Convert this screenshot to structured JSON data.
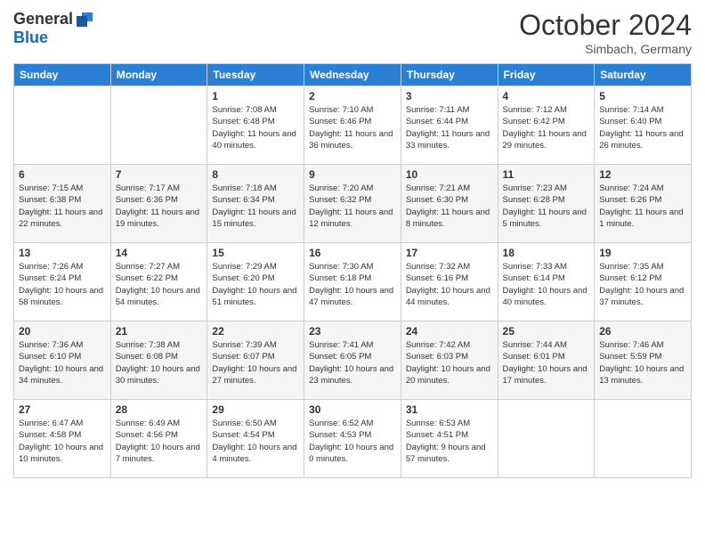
{
  "header": {
    "logo_general": "General",
    "logo_blue": "Blue",
    "month_title": "October 2024",
    "subtitle": "Simbach, Germany"
  },
  "days_of_week": [
    "Sunday",
    "Monday",
    "Tuesday",
    "Wednesday",
    "Thursday",
    "Friday",
    "Saturday"
  ],
  "weeks": [
    [
      {
        "day": "",
        "info": ""
      },
      {
        "day": "",
        "info": ""
      },
      {
        "day": "1",
        "info": "Sunrise: 7:08 AM\nSunset: 6:48 PM\nDaylight: 11 hours and 40 minutes."
      },
      {
        "day": "2",
        "info": "Sunrise: 7:10 AM\nSunset: 6:46 PM\nDaylight: 11 hours and 36 minutes."
      },
      {
        "day": "3",
        "info": "Sunrise: 7:11 AM\nSunset: 6:44 PM\nDaylight: 11 hours and 33 minutes."
      },
      {
        "day": "4",
        "info": "Sunrise: 7:12 AM\nSunset: 6:42 PM\nDaylight: 11 hours and 29 minutes."
      },
      {
        "day": "5",
        "info": "Sunrise: 7:14 AM\nSunset: 6:40 PM\nDaylight: 11 hours and 26 minutes."
      }
    ],
    [
      {
        "day": "6",
        "info": "Sunrise: 7:15 AM\nSunset: 6:38 PM\nDaylight: 11 hours and 22 minutes."
      },
      {
        "day": "7",
        "info": "Sunrise: 7:17 AM\nSunset: 6:36 PM\nDaylight: 11 hours and 19 minutes."
      },
      {
        "day": "8",
        "info": "Sunrise: 7:18 AM\nSunset: 6:34 PM\nDaylight: 11 hours and 15 minutes."
      },
      {
        "day": "9",
        "info": "Sunrise: 7:20 AM\nSunset: 6:32 PM\nDaylight: 11 hours and 12 minutes."
      },
      {
        "day": "10",
        "info": "Sunrise: 7:21 AM\nSunset: 6:30 PM\nDaylight: 11 hours and 8 minutes."
      },
      {
        "day": "11",
        "info": "Sunrise: 7:23 AM\nSunset: 6:28 PM\nDaylight: 11 hours and 5 minutes."
      },
      {
        "day": "12",
        "info": "Sunrise: 7:24 AM\nSunset: 6:26 PM\nDaylight: 11 hours and 1 minute."
      }
    ],
    [
      {
        "day": "13",
        "info": "Sunrise: 7:26 AM\nSunset: 6:24 PM\nDaylight: 10 hours and 58 minutes."
      },
      {
        "day": "14",
        "info": "Sunrise: 7:27 AM\nSunset: 6:22 PM\nDaylight: 10 hours and 54 minutes."
      },
      {
        "day": "15",
        "info": "Sunrise: 7:29 AM\nSunset: 6:20 PM\nDaylight: 10 hours and 51 minutes."
      },
      {
        "day": "16",
        "info": "Sunrise: 7:30 AM\nSunset: 6:18 PM\nDaylight: 10 hours and 47 minutes."
      },
      {
        "day": "17",
        "info": "Sunrise: 7:32 AM\nSunset: 6:16 PM\nDaylight: 10 hours and 44 minutes."
      },
      {
        "day": "18",
        "info": "Sunrise: 7:33 AM\nSunset: 6:14 PM\nDaylight: 10 hours and 40 minutes."
      },
      {
        "day": "19",
        "info": "Sunrise: 7:35 AM\nSunset: 6:12 PM\nDaylight: 10 hours and 37 minutes."
      }
    ],
    [
      {
        "day": "20",
        "info": "Sunrise: 7:36 AM\nSunset: 6:10 PM\nDaylight: 10 hours and 34 minutes."
      },
      {
        "day": "21",
        "info": "Sunrise: 7:38 AM\nSunset: 6:08 PM\nDaylight: 10 hours and 30 minutes."
      },
      {
        "day": "22",
        "info": "Sunrise: 7:39 AM\nSunset: 6:07 PM\nDaylight: 10 hours and 27 minutes."
      },
      {
        "day": "23",
        "info": "Sunrise: 7:41 AM\nSunset: 6:05 PM\nDaylight: 10 hours and 23 minutes."
      },
      {
        "day": "24",
        "info": "Sunrise: 7:42 AM\nSunset: 6:03 PM\nDaylight: 10 hours and 20 minutes."
      },
      {
        "day": "25",
        "info": "Sunrise: 7:44 AM\nSunset: 6:01 PM\nDaylight: 10 hours and 17 minutes."
      },
      {
        "day": "26",
        "info": "Sunrise: 7:46 AM\nSunset: 5:59 PM\nDaylight: 10 hours and 13 minutes."
      }
    ],
    [
      {
        "day": "27",
        "info": "Sunrise: 6:47 AM\nSunset: 4:58 PM\nDaylight: 10 hours and 10 minutes."
      },
      {
        "day": "28",
        "info": "Sunrise: 6:49 AM\nSunset: 4:56 PM\nDaylight: 10 hours and 7 minutes."
      },
      {
        "day": "29",
        "info": "Sunrise: 6:50 AM\nSunset: 4:54 PM\nDaylight: 10 hours and 4 minutes."
      },
      {
        "day": "30",
        "info": "Sunrise: 6:52 AM\nSunset: 4:53 PM\nDaylight: 10 hours and 0 minutes."
      },
      {
        "day": "31",
        "info": "Sunrise: 6:53 AM\nSunset: 4:51 PM\nDaylight: 9 hours and 57 minutes."
      },
      {
        "day": "",
        "info": ""
      },
      {
        "day": "",
        "info": ""
      }
    ]
  ]
}
